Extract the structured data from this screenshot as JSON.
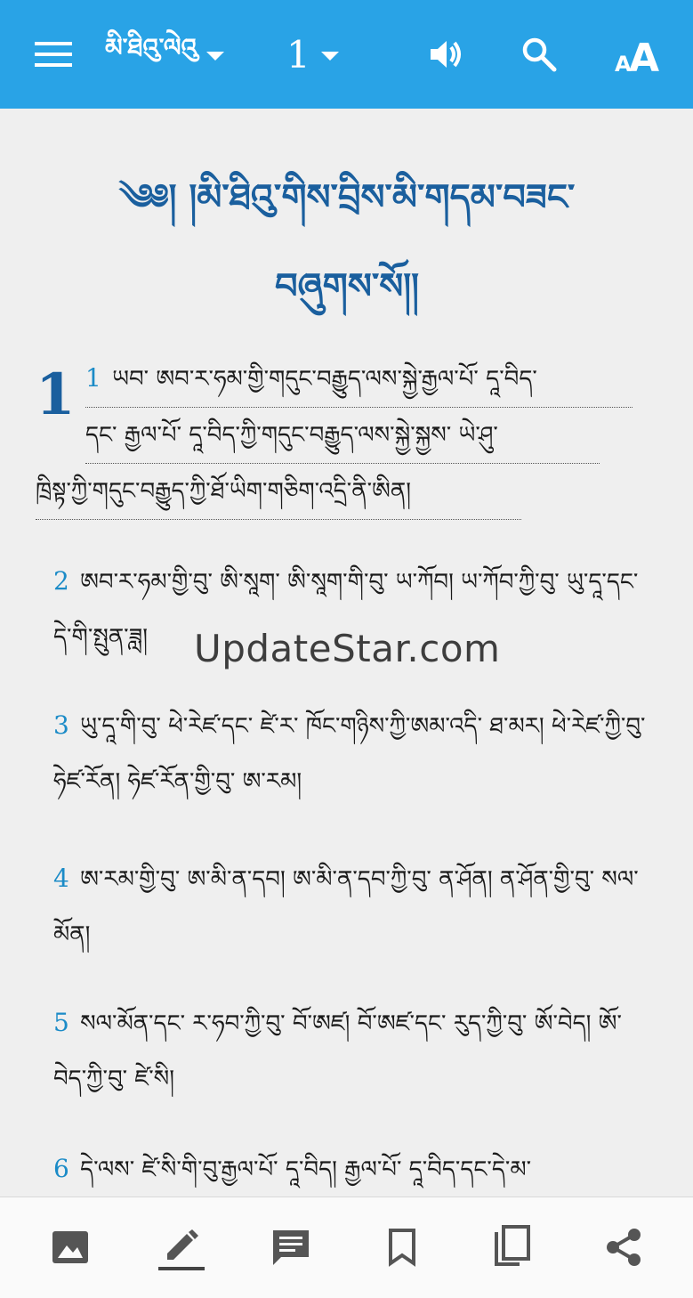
{
  "appbar": {
    "book_label": "མི་ཐིའུ་ལེའུ",
    "chapter_label": "1",
    "bg_color": "#29a3e6",
    "icons": [
      "menu-icon",
      "chevron-down-icon",
      "volume-icon",
      "search-icon",
      "text-size-icon"
    ]
  },
  "content": {
    "title_line1": "༄༅། །མི་ཐིའུ་གིས་བྲིས་མི་གདམ་བཟང་",
    "title_line2": "བཞུགས་སོ།།",
    "chapter_number": "1",
    "verses": [
      {
        "num": "1",
        "lines": [
          "ཡབ་ ཨབ་ར་ཧམ་གྱི་གདུང་བརྒྱུད་ལས་སྐྱེ་རྒྱལ་པོ་ དཱ་བིད་",
          "དང་ རྒྱལ་པོ་ དཱ་བིད་ཀྱི་གདུང་བརྒྱུད་ལས་སྐྱེ་སྐྱས་ ཡེ་ཤུ་",
          "ཁྲིསྟ་ཀྱི་གདུང་བརྒྱུད་ཀྱི་ཐོ་ཡིག་གཅིག་འདྲི་ནི་ཨིན།"
        ]
      },
      {
        "num": "2",
        "text": "ཨབ་ར་ཧམ་གྱི་བུ་ ཨི་སཱག་ ཨི་སཱག་གི་བུ་ ཡ་ཀོབ། ཡ་ཀོབ་ཀྱི་བུ་ ཡུ་དཱ་དང་དེ་གི་སྤུན་ཟླ།"
      },
      {
        "num": "3",
        "text": "ཡུ་དཱ་གི་བུ་ ཕེ་རེཛ་དང་ ཛེ་ར་ ཁོང་གཉིས་ཀྱི་ཨམ་འདི་ ཐ་མར། ཕེ་རེཛ་ཀྱི་བུ་ ཧེཛ་རོན། ཧེཛ་རོན་གྱི་བུ་ ཨ་རམ།"
      },
      {
        "num": "4",
        "text": "ཨ་རམ་གྱི་བུ་ ཨ་མི་ན་དབ། ཨ་མི་ན་དབ་ཀྱི་བུ་ ན་ཤོན། ན་ཤོན་གྱི་བུ་ སལ་མོན།"
      },
      {
        "num": "5",
        "text": "སལ་མོན་དང་ ར་ཧབ་ཀྱི་བུ་ བོ་ཨཛ། བོ་ཨཛ་དང་ རུད་ཀྱི་བུ་ ཨོ་བེད། ཨོ་བེད་ཀྱི་བུ་ ཛེ་སི།"
      },
      {
        "num": "6",
        "text": "དེ་ལས་ ཛེ་སི་གི་བུ་རྒྱལ་པོ་ དཱ་བིད། རྒྱལ་པོ་ དཱ་བིད་དང་དེ་མ་"
      }
    ]
  },
  "watermark": "UpdateStar.com",
  "bottombar": {
    "icons": [
      "image-icon",
      "pencil-icon",
      "comment-icon",
      "bookmark-icon",
      "copy-icon",
      "share-icon"
    ]
  }
}
